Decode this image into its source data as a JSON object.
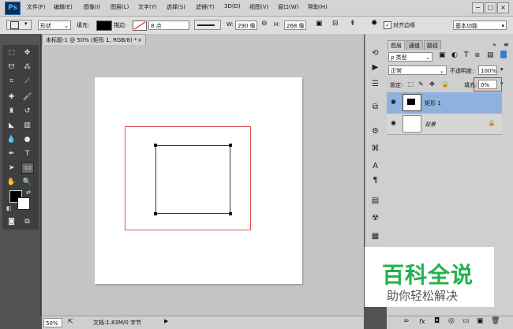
{
  "app": {
    "logo": "Ps"
  },
  "menu": [
    "文件(F)",
    "编辑(E)",
    "图像(I)",
    "图层(L)",
    "文字(Y)",
    "选择(S)",
    "滤镜(T)",
    "3D(D)",
    "视图(V)",
    "窗口(W)",
    "帮助(H)"
  ],
  "window_controls": [
    "−",
    "□",
    "×"
  ],
  "options": {
    "mode": "形状",
    "fill_label": "填充:",
    "stroke_label": "描边:",
    "stroke_size": "8 点",
    "w_label": "W:",
    "w_value": "290 像",
    "h_label": "H:",
    "h_value": "268 像",
    "align_edges": "对齐边缘",
    "workspace": "基本功能"
  },
  "document": {
    "tab_title": "未标题-1 @ 50% (矩形 1, RGB/8) *",
    "tab_close": "×"
  },
  "status": {
    "zoom": "50%",
    "doc_info": "文档:1.83M/0 字节"
  },
  "layers_panel": {
    "tabs": [
      "图层",
      "通道",
      "路径"
    ],
    "filter_kind": "ρ 类型",
    "blend_mode": "正常",
    "opacity_label": "不透明度:",
    "opacity_value": "100%",
    "lock_label": "锁定:",
    "fill_label": "填充:",
    "fill_value": "0%",
    "layers": [
      {
        "name": "矩形 1",
        "selected": true
      },
      {
        "name": "背景",
        "locked": true
      }
    ],
    "bottom_icons": [
      "∞",
      "fx",
      "◘",
      "◎",
      "▭",
      "▣",
      "🗑"
    ]
  },
  "watermark": {
    "title": "百科全说",
    "subtitle": "助你轻松解决"
  },
  "colors": {
    "accent_selection": "#8fb1dd",
    "guide_red": "#e05050",
    "highlight_box": "#e03030",
    "watermark_green": "#22b14c"
  }
}
